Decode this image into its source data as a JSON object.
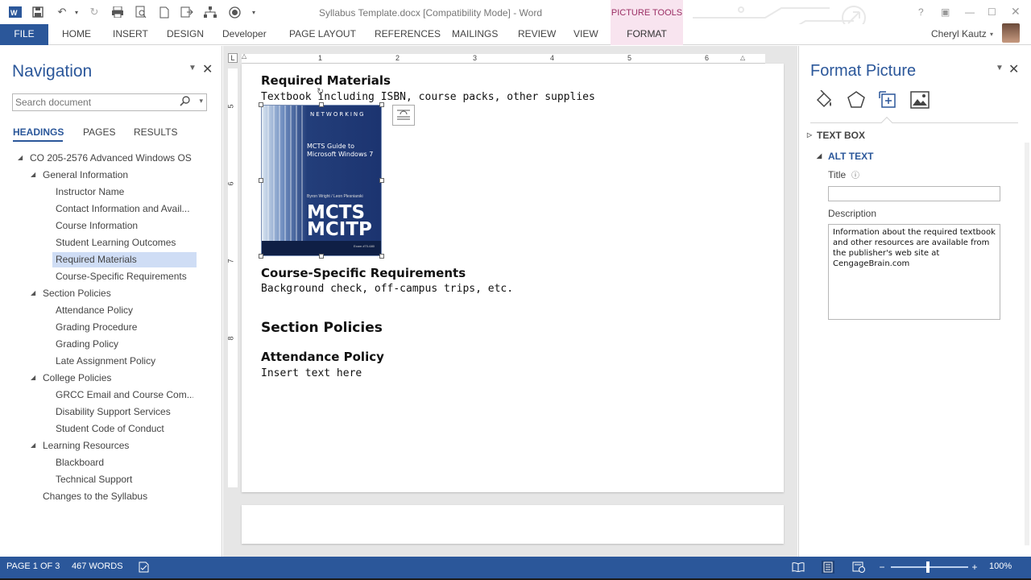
{
  "window": {
    "title": "Syllabus Template.docx [Compatibility Mode] - Word",
    "contextual_tab_group": "PICTURE TOOLS",
    "user_name": "Cheryl Kautz",
    "help": "?"
  },
  "quick_access_toolbar": [
    "word-logo-icon",
    "save-icon",
    "undo-icon",
    "redo-icon",
    "print-icon",
    "print-preview-icon",
    "new-document-icon",
    "send-icon",
    "tree-icon",
    "record-icon",
    "customize-icon"
  ],
  "ribbon": {
    "tabs": [
      "FILE",
      "HOME",
      "INSERT",
      "DESIGN",
      "Developer",
      "PAGE LAYOUT",
      "REFERENCES",
      "MAILINGS",
      "REVIEW",
      "VIEW",
      "FORMAT"
    ],
    "active_contextual_tab": "FORMAT",
    "file_tab_color": "#2b579a"
  },
  "navigation": {
    "title": "Navigation",
    "search_placeholder": "Search document",
    "subtabs": [
      "HEADINGS",
      "PAGES",
      "RESULTS"
    ],
    "active_subtab": "HEADINGS",
    "tree": [
      {
        "label": "CO 205-2576 Advanced Windows OS",
        "level": 0,
        "expanded": true
      },
      {
        "label": "General Information",
        "level": 1,
        "expanded": true
      },
      {
        "label": "Instructor Name",
        "level": 2
      },
      {
        "label": "Contact Information and Avail...",
        "level": 2
      },
      {
        "label": "Course Information",
        "level": 2
      },
      {
        "label": "Student Learning Outcomes",
        "level": 2
      },
      {
        "label": "Required Materials",
        "level": 2,
        "selected": true
      },
      {
        "label": "Course-Specific Requirements",
        "level": 2
      },
      {
        "label": "Section Policies",
        "level": 1,
        "expanded": true
      },
      {
        "label": "Attendance Policy",
        "level": 2
      },
      {
        "label": "Grading Procedure",
        "level": 2
      },
      {
        "label": "Grading Policy",
        "level": 2
      },
      {
        "label": "Late Assignment Policy",
        "level": 2
      },
      {
        "label": "College Policies",
        "level": 1,
        "expanded": true
      },
      {
        "label": "GRCC Email and Course Com...",
        "level": 2
      },
      {
        "label": "Disability Support Services",
        "level": 2
      },
      {
        "label": "Student Code of Conduct",
        "level": 2
      },
      {
        "label": "Learning Resources",
        "level": 1,
        "expanded": true
      },
      {
        "label": "Blackboard",
        "level": 2
      },
      {
        "label": "Technical Support",
        "level": 2
      },
      {
        "label": "Changes to the Syllabus",
        "level": 1
      }
    ]
  },
  "ruler": {
    "corner": "L",
    "h_numbers": [
      "1",
      "2",
      "3",
      "4",
      "5",
      "6"
    ],
    "v_numbers": [
      "5",
      "6",
      "7",
      "8"
    ]
  },
  "document": {
    "required_materials_heading": "Required Materials",
    "required_materials_text": "Textbook including ISBN, course packs, other supplies",
    "course_requirements_heading": "Course-Specific Requirements",
    "course_requirements_text": "Background check, off-campus trips, etc.",
    "section_policies_heading": "Section Policies",
    "attendance_heading": "Attendance Policy",
    "attendance_text": "Insert text here",
    "book_cover": {
      "series": "NETWORKING",
      "title": "MCTS Guide to Microsoft Windows 7",
      "authors": "Byron Wright / Leon Plesniarski",
      "big_text_1": "MCTS",
      "big_text_2": "MCITP",
      "exam_text": "Exam #70-680"
    }
  },
  "format_picture": {
    "title": "Format Picture",
    "icons": [
      "fill-line-icon",
      "effects-icon",
      "size-properties-icon",
      "picture-icon"
    ],
    "sections": {
      "text_box": "TEXT BOX",
      "alt_text": "ALT TEXT"
    },
    "title_label": "Title",
    "title_value": "",
    "description_label": "Description",
    "description_value": "Information about the required textbook and other resources are available from the publisher's web site at CengageBrain.com"
  },
  "status_bar": {
    "page": "PAGE 1 OF 3",
    "words": "467 WORDS",
    "zoom": "100%",
    "zoom_level_percent": 100,
    "color": "#2b579a"
  }
}
